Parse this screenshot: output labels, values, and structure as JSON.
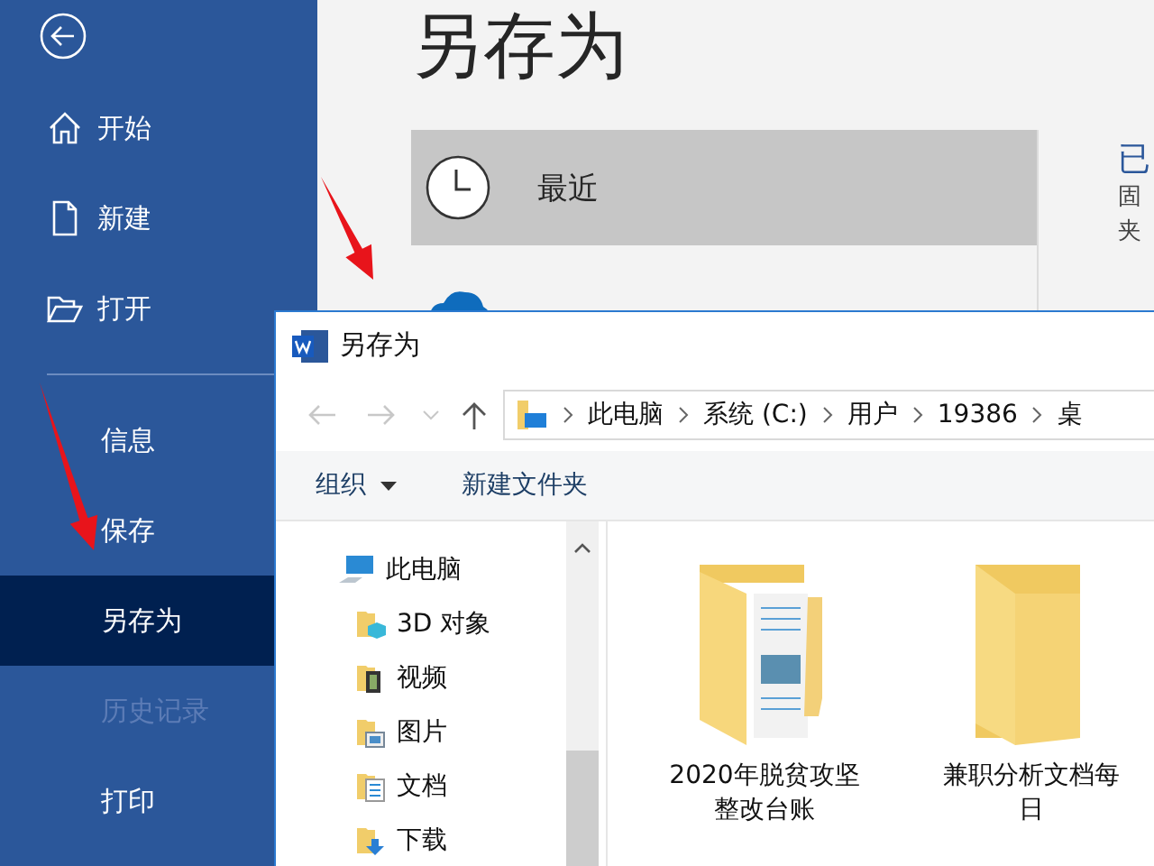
{
  "backstage": {
    "sidebar": {
      "groups": [
        [
          {
            "label": "开始",
            "selected": false,
            "disabled": false
          },
          {
            "label": "新建",
            "selected": false,
            "disabled": false
          },
          {
            "label": "打开",
            "selected": false,
            "disabled": false
          }
        ],
        [
          {
            "label": "信息",
            "selected": false,
            "disabled": false
          },
          {
            "label": "保存",
            "selected": false,
            "disabled": false
          },
          {
            "label": "另存为",
            "selected": true,
            "disabled": false
          },
          {
            "label": "历史记录",
            "selected": false,
            "disabled": true
          },
          {
            "label": "打印",
            "selected": false,
            "disabled": false
          }
        ]
      ]
    },
    "title": "另存为",
    "locations": [
      {
        "label": "最近",
        "selected": true
      },
      {
        "selected": false
      }
    ],
    "pinned": {
      "heading": "已",
      "lines": [
        "固",
        "夹"
      ]
    }
  },
  "dialog": {
    "title": "另存为",
    "breadcrumb": [
      "此电脑",
      "系统 (C:)",
      "用户",
      "19386",
      "桌"
    ],
    "toolbar": {
      "organize": "组织",
      "new_folder": "新建文件夹"
    },
    "tree": [
      {
        "label": "此电脑",
        "children": [
          {
            "label": "3D 对象"
          },
          {
            "label": "视频"
          },
          {
            "label": "图片"
          },
          {
            "label": "文档"
          },
          {
            "label": "下载"
          }
        ]
      }
    ],
    "files": [
      {
        "name_lines": [
          "2020年脱贫攻坚",
          "整改台账"
        ],
        "kind": "documents-folder"
      },
      {
        "name_lines": [
          "兼职分析文档每",
          "日"
        ],
        "kind": "empty-folder"
      }
    ]
  }
}
